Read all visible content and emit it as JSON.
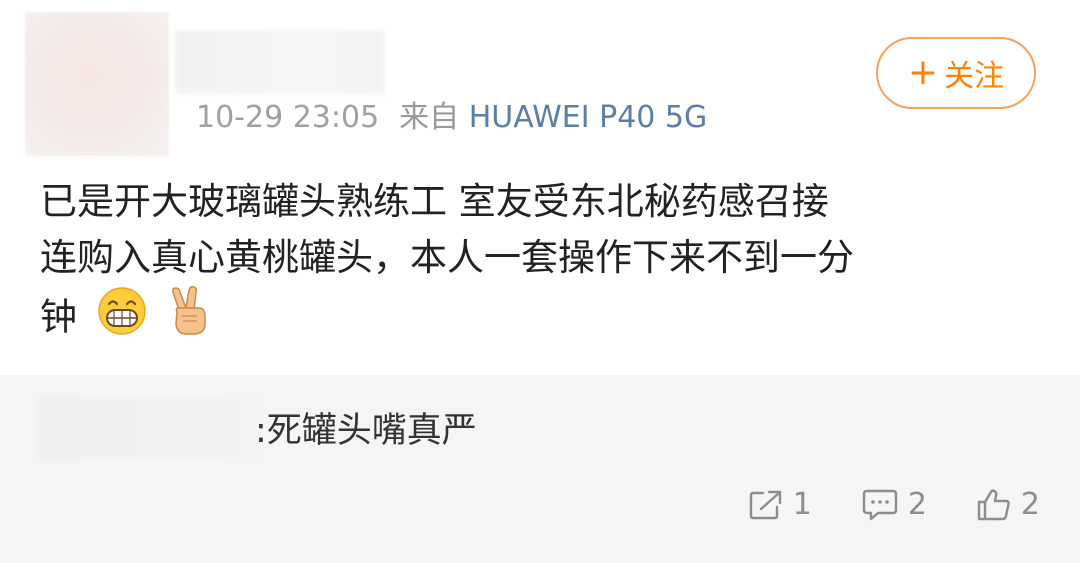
{
  "post": {
    "time": "10-29 23:05",
    "from_label": "来自",
    "device": "HUAWEI P40 5G",
    "follow_plus": "+",
    "follow_label": "关注",
    "content_lines": [
      "已是开大玻璃罐头熟练工 室友受东北秘药感召接",
      "连购入真心黄桃罐头，本人一套操作下来不到一分",
      "钟"
    ],
    "emojis": [
      "grinning-face-icon",
      "victory-hand-icon"
    ]
  },
  "repost": {
    "text": ":死罐头嘴真严"
  },
  "actions": {
    "repost_count": "1",
    "comment_count": "2",
    "like_count": "2"
  },
  "colors": {
    "accent_orange": "#ff8200",
    "device_blue": "#5b7fa5",
    "meta_gray": "#9a9a9a",
    "repost_bg": "#f5f5f5"
  }
}
